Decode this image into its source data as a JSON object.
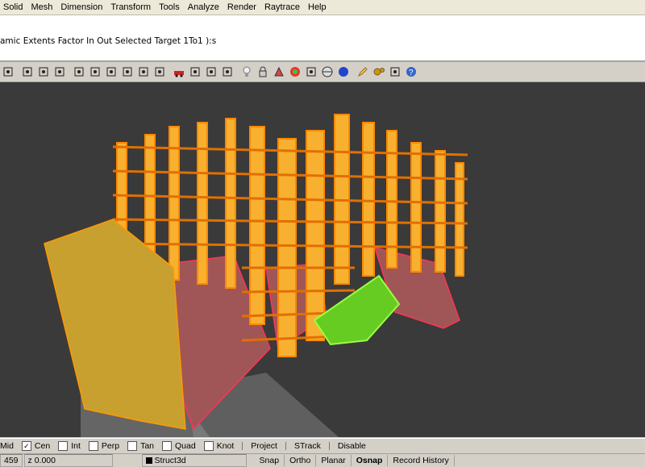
{
  "menu": [
    "Solid",
    "Mesh",
    "Dimension",
    "Transform",
    "Tools",
    "Analyze",
    "Render",
    "Raytrace",
    "Help"
  ],
  "command_history": "amic  Extents  Factor  In  Out  Selected  Target  1To1 ):s",
  "toolbar_icons": [
    "new-file-icon",
    "undo-icon",
    "pan-hand-icon",
    "rotate-view-icon",
    "zoom-icon",
    "zoom-window-icon",
    "zoom-extents-icon",
    "zoom-selected-icon",
    "undo-view-icon",
    "four-viewports-icon",
    "car-icon",
    "camera-icon",
    "target-icon",
    "set-cplane-icon",
    "bulb-icon",
    "lock-icon",
    "shade-icon",
    "color-wheel-icon",
    "sphere-wire-icon",
    "globe-icon",
    "blue-sphere-icon",
    "pencil-icon",
    "gears-icon",
    "dimension-icon",
    "help-icon"
  ],
  "osnaps": [
    {
      "label": "Mid",
      "checked": false,
      "style": "none"
    },
    {
      "label": "Cen",
      "checked": true,
      "style": "box"
    },
    {
      "label": "Int",
      "checked": false,
      "style": "box"
    },
    {
      "label": "Perp",
      "checked": false,
      "style": "box"
    },
    {
      "label": "Tan",
      "checked": false,
      "style": "box"
    },
    {
      "label": "Quad",
      "checked": false,
      "style": "box"
    },
    {
      "label": "Knot",
      "checked": false,
      "style": "box"
    },
    {
      "label": "Project",
      "checked": false,
      "style": "flat"
    },
    {
      "label": "STrack",
      "checked": false,
      "style": "flat"
    },
    {
      "label": "Disable",
      "checked": false,
      "style": "flat"
    }
  ],
  "status": {
    "coord_x": "459",
    "coord_z": "z 0.000",
    "layer": "Struct3d",
    "layer_color": "#000000",
    "buttons": [
      {
        "label": "Snap",
        "on": false
      },
      {
        "label": "Ortho",
        "on": false
      },
      {
        "label": "Planar",
        "on": false
      },
      {
        "label": "Osnap",
        "on": true
      },
      {
        "label": "Record History",
        "on": false
      }
    ]
  },
  "colors": {
    "viewport_bg": "#3a3a3a",
    "structure": "#f0a020",
    "floor_plate": "#a05050",
    "highlight": "#66cc22"
  }
}
